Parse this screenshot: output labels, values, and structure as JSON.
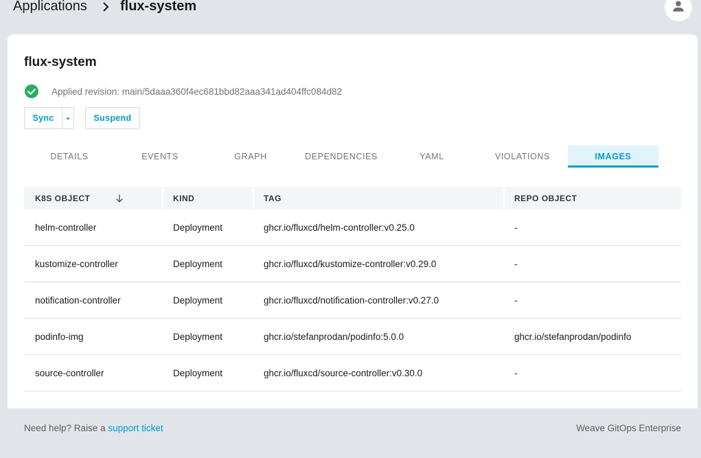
{
  "breadcrumb": {
    "root": "Applications",
    "current": "flux-system"
  },
  "page": {
    "title": "flux-system",
    "status_text": "Applied revision: main/5daaa360f4ec681bbd82aaa341ad404ffc084d82"
  },
  "actions": {
    "sync_label": "Sync",
    "suspend_label": "Suspend"
  },
  "tabs": [
    {
      "label": "DETAILS",
      "active": false
    },
    {
      "label": "EVENTS",
      "active": false
    },
    {
      "label": "GRAPH",
      "active": false
    },
    {
      "label": "DEPENDENCIES",
      "active": false
    },
    {
      "label": "YAML",
      "active": false
    },
    {
      "label": "VIOLATIONS",
      "active": false
    },
    {
      "label": "IMAGES",
      "active": true
    }
  ],
  "table": {
    "columns": [
      "K8S OBJECT",
      "KIND",
      "TAG",
      "REPO OBJECT"
    ],
    "rows": [
      [
        "helm-controller",
        "Deployment",
        "ghcr.io/fluxcd/helm-controller:v0.25.0",
        "-"
      ],
      [
        "kustomize-controller",
        "Deployment",
        "ghcr.io/fluxcd/kustomize-controller:v0.29.0",
        "-"
      ],
      [
        "notification-controller",
        "Deployment",
        "ghcr.io/fluxcd/notification-controller:v0.27.0",
        "-"
      ],
      [
        "podinfo-img",
        "Deployment",
        "ghcr.io/stefanprodan/podinfo:5.0.0",
        "ghcr.io/stefanprodan/podinfo"
      ],
      [
        "source-controller",
        "Deployment",
        "ghcr.io/fluxcd/source-controller:v0.30.0",
        "-"
      ]
    ]
  },
  "footer": {
    "help_prefix": "Need help? Raise a",
    "help_link": "support ticket",
    "brand": "Weave GitOps Enterprise"
  },
  "colors": {
    "accent": "#009ccc",
    "success": "#27ae60",
    "background": "#e1e5ea"
  },
  "icons": {
    "breadcrumb_separator": "chevron-right-icon",
    "user": "user-icon",
    "status": "check-circle-icon",
    "sync_menu": "caret-down-icon",
    "sort": "arrow-down-icon"
  }
}
